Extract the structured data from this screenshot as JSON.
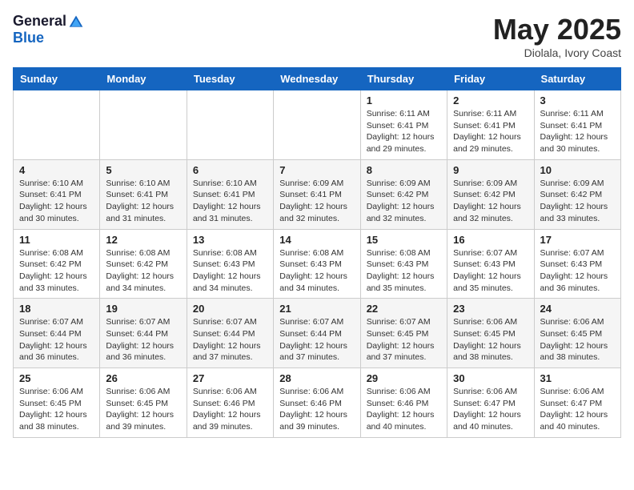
{
  "header": {
    "logo_general": "General",
    "logo_blue": "Blue",
    "month": "May 2025",
    "location": "Diolala, Ivory Coast"
  },
  "weekdays": [
    "Sunday",
    "Monday",
    "Tuesday",
    "Wednesday",
    "Thursday",
    "Friday",
    "Saturday"
  ],
  "weeks": [
    [
      {
        "day": "",
        "text": ""
      },
      {
        "day": "",
        "text": ""
      },
      {
        "day": "",
        "text": ""
      },
      {
        "day": "",
        "text": ""
      },
      {
        "day": "1",
        "text": "Sunrise: 6:11 AM\nSunset: 6:41 PM\nDaylight: 12 hours and 29 minutes."
      },
      {
        "day": "2",
        "text": "Sunrise: 6:11 AM\nSunset: 6:41 PM\nDaylight: 12 hours and 29 minutes."
      },
      {
        "day": "3",
        "text": "Sunrise: 6:11 AM\nSunset: 6:41 PM\nDaylight: 12 hours and 30 minutes."
      }
    ],
    [
      {
        "day": "4",
        "text": "Sunrise: 6:10 AM\nSunset: 6:41 PM\nDaylight: 12 hours and 30 minutes."
      },
      {
        "day": "5",
        "text": "Sunrise: 6:10 AM\nSunset: 6:41 PM\nDaylight: 12 hours and 31 minutes."
      },
      {
        "day": "6",
        "text": "Sunrise: 6:10 AM\nSunset: 6:41 PM\nDaylight: 12 hours and 31 minutes."
      },
      {
        "day": "7",
        "text": "Sunrise: 6:09 AM\nSunset: 6:41 PM\nDaylight: 12 hours and 32 minutes."
      },
      {
        "day": "8",
        "text": "Sunrise: 6:09 AM\nSunset: 6:42 PM\nDaylight: 12 hours and 32 minutes."
      },
      {
        "day": "9",
        "text": "Sunrise: 6:09 AM\nSunset: 6:42 PM\nDaylight: 12 hours and 32 minutes."
      },
      {
        "day": "10",
        "text": "Sunrise: 6:09 AM\nSunset: 6:42 PM\nDaylight: 12 hours and 33 minutes."
      }
    ],
    [
      {
        "day": "11",
        "text": "Sunrise: 6:08 AM\nSunset: 6:42 PM\nDaylight: 12 hours and 33 minutes."
      },
      {
        "day": "12",
        "text": "Sunrise: 6:08 AM\nSunset: 6:42 PM\nDaylight: 12 hours and 34 minutes."
      },
      {
        "day": "13",
        "text": "Sunrise: 6:08 AM\nSunset: 6:43 PM\nDaylight: 12 hours and 34 minutes."
      },
      {
        "day": "14",
        "text": "Sunrise: 6:08 AM\nSunset: 6:43 PM\nDaylight: 12 hours and 34 minutes."
      },
      {
        "day": "15",
        "text": "Sunrise: 6:08 AM\nSunset: 6:43 PM\nDaylight: 12 hours and 35 minutes."
      },
      {
        "day": "16",
        "text": "Sunrise: 6:07 AM\nSunset: 6:43 PM\nDaylight: 12 hours and 35 minutes."
      },
      {
        "day": "17",
        "text": "Sunrise: 6:07 AM\nSunset: 6:43 PM\nDaylight: 12 hours and 36 minutes."
      }
    ],
    [
      {
        "day": "18",
        "text": "Sunrise: 6:07 AM\nSunset: 6:44 PM\nDaylight: 12 hours and 36 minutes."
      },
      {
        "day": "19",
        "text": "Sunrise: 6:07 AM\nSunset: 6:44 PM\nDaylight: 12 hours and 36 minutes."
      },
      {
        "day": "20",
        "text": "Sunrise: 6:07 AM\nSunset: 6:44 PM\nDaylight: 12 hours and 37 minutes."
      },
      {
        "day": "21",
        "text": "Sunrise: 6:07 AM\nSunset: 6:44 PM\nDaylight: 12 hours and 37 minutes."
      },
      {
        "day": "22",
        "text": "Sunrise: 6:07 AM\nSunset: 6:45 PM\nDaylight: 12 hours and 37 minutes."
      },
      {
        "day": "23",
        "text": "Sunrise: 6:06 AM\nSunset: 6:45 PM\nDaylight: 12 hours and 38 minutes."
      },
      {
        "day": "24",
        "text": "Sunrise: 6:06 AM\nSunset: 6:45 PM\nDaylight: 12 hours and 38 minutes."
      }
    ],
    [
      {
        "day": "25",
        "text": "Sunrise: 6:06 AM\nSunset: 6:45 PM\nDaylight: 12 hours and 38 minutes."
      },
      {
        "day": "26",
        "text": "Sunrise: 6:06 AM\nSunset: 6:45 PM\nDaylight: 12 hours and 39 minutes."
      },
      {
        "day": "27",
        "text": "Sunrise: 6:06 AM\nSunset: 6:46 PM\nDaylight: 12 hours and 39 minutes."
      },
      {
        "day": "28",
        "text": "Sunrise: 6:06 AM\nSunset: 6:46 PM\nDaylight: 12 hours and 39 minutes."
      },
      {
        "day": "29",
        "text": "Sunrise: 6:06 AM\nSunset: 6:46 PM\nDaylight: 12 hours and 40 minutes."
      },
      {
        "day": "30",
        "text": "Sunrise: 6:06 AM\nSunset: 6:47 PM\nDaylight: 12 hours and 40 minutes."
      },
      {
        "day": "31",
        "text": "Sunrise: 6:06 AM\nSunset: 6:47 PM\nDaylight: 12 hours and 40 minutes."
      }
    ]
  ]
}
